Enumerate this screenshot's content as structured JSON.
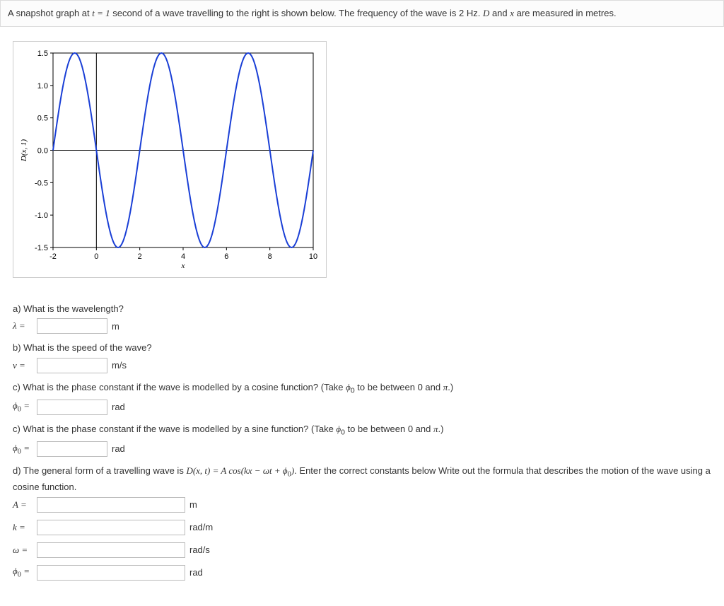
{
  "intro": {
    "pre": "A snapshot graph at ",
    "t_expr": "t = 1",
    "mid": " second of a wave travelling to the right is shown below. The frequency of the wave is ",
    "freq": "2 Hz",
    "post": ". ",
    "D": "D",
    "and": " and ",
    "x": "x",
    "tail": " are measured in metres."
  },
  "chart_data": {
    "type": "line",
    "xlabel": "x",
    "ylabel": "D(x, 1)",
    "xlim": [
      -2,
      10
    ],
    "ylim": [
      -1.5,
      1.5
    ],
    "xticks": [
      -2,
      0,
      2,
      4,
      6,
      8,
      10
    ],
    "yticks": [
      -1.5,
      -1.0,
      -0.5,
      0.0,
      0.5,
      1.0,
      1.5
    ],
    "amplitude": 1.5,
    "wavelength": 4,
    "phase_shift_x": -1,
    "series": [
      {
        "name": "D(x,1)",
        "function": "1.5*cos(2*pi*(x+1)/4)"
      }
    ]
  },
  "qa": {
    "q_a": "a) What is the wavelength?",
    "lambda_label": "λ =",
    "m": "m",
    "q_b": "b) What is the speed of the wave?",
    "v_label": "v =",
    "ms": "m/s",
    "q_c1_pre": "c) What is the phase constant if the wave is modelled by a cosine function? (Take ",
    "phi0": "ϕ",
    "q_c1_mid": " to be between ",
    "zero": "0",
    "and": " and ",
    "pi": "π",
    "q_c1_post": ".)",
    "phi_label": "ϕ",
    "eq": " =",
    "rad": "rad",
    "q_c2_pre": "c) What is the phase constant if the wave is modelled by a sine function? (Take ",
    "q_d_pre": "d) The general form of a travelling wave is ",
    "q_d_formula": "D(x, t) = A cos(kx − ωt + ϕ",
    "q_d_formula_post": ")",
    "q_d_post": ". Enter the correct constants below Write out the formula that describes the motion of the wave using a cosine function.",
    "A_label": "A =",
    "k_label": "k =",
    "omega_label": "ω =",
    "radm": "rad/m",
    "rads": "rad/s"
  }
}
